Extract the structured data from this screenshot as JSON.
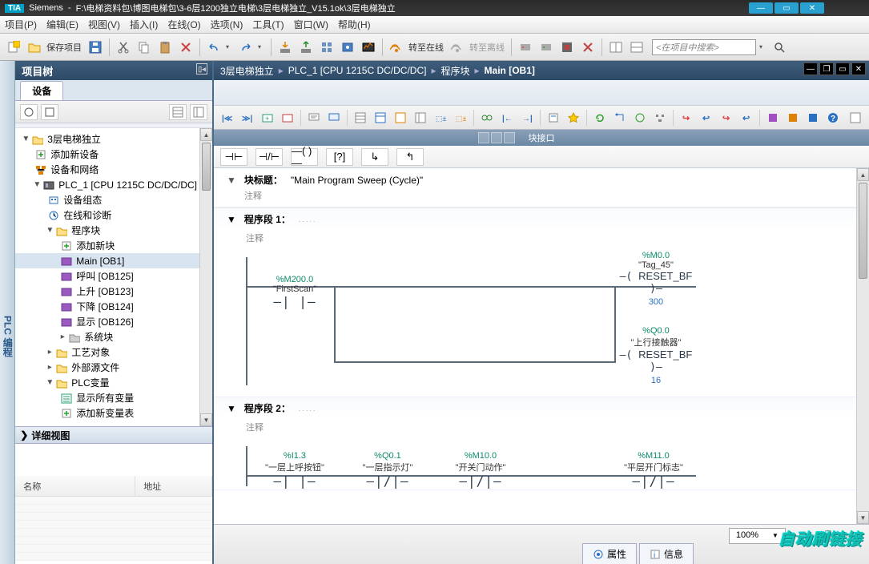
{
  "titlebar": {
    "logo": "TIA",
    "app": "Siemens",
    "path": "F:\\电梯资料包\\博图电梯包\\3-6层1200独立电梯\\3层电梯独立_V15.1ok\\3层电梯独立"
  },
  "menu": {
    "project": "项目(P)",
    "edit": "编辑(E)",
    "view": "视图(V)",
    "insert": "插入(I)",
    "online": "在线(O)",
    "options": "选项(N)",
    "tools": "工具(T)",
    "window": "窗口(W)",
    "help": "帮助(H)"
  },
  "toolbar": {
    "save": "保存项目",
    "go_online": "转至在线",
    "go_offline": "转至离线",
    "search_placeholder": "<在项目中搜索>"
  },
  "side_tab": "PLC 编程",
  "project_tree": {
    "title": "项目树",
    "tab": "设备",
    "root": "3层电梯独立",
    "add_device": "添加新设备",
    "devices_networks": "设备和网络",
    "plc": "PLC_1 [CPU 1215C DC/DC/DC]",
    "device_config": "设备组态",
    "online_diag": "在线和诊断",
    "program_blocks": "程序块",
    "add_block": "添加新块",
    "main": "Main [OB1]",
    "ob125": "呼叫 [OB125]",
    "ob123": "上升 [OB123]",
    "ob124": "下降 [OB124]",
    "ob126": "显示 [OB126]",
    "system_blocks": "系统块",
    "tech_objects": "工艺对象",
    "ext_sources": "外部源文件",
    "plc_tags": "PLC变量",
    "show_all_tags": "显示所有变量",
    "add_tag_table": "添加新变量表"
  },
  "detail": {
    "title": "详细视图",
    "col_name": "名称",
    "col_addr": "地址"
  },
  "editor": {
    "crumb1": "3层电梯独立",
    "crumb2": "PLC_1 [CPU 1215C DC/DC/DC]",
    "crumb3": "程序块",
    "crumb4": "Main [OB1]",
    "interface": "块接口",
    "block_title_label": "块标题：",
    "block_title_value": "\"Main Program Sweep (Cycle)\"",
    "comment": "注释",
    "network1": "程序段 1：",
    "network2": "程序段 2：",
    "zoom": "100%"
  },
  "rung1": {
    "contact_addr": "%M200.0",
    "contact_name": "\"FirstScan\"",
    "coil1_addr": "%M0.0",
    "coil1_name": "\"Tag_45\"",
    "coil1_func": "RESET_BF",
    "coil1_param": "300",
    "coil2_addr": "%Q0.0",
    "coil2_name": "\"上行接触器\"",
    "coil2_func": "RESET_BF",
    "coil2_param": "16"
  },
  "rung2": {
    "c1_addr": "%I1.3",
    "c1_name": "\"一层上呼按钮\"",
    "c2_addr": "%Q0.1",
    "c2_name": "\"一层指示灯\"",
    "c3_addr": "%M10.0",
    "c3_name": "\"开关门动作\"",
    "c4_addr": "%M11.0",
    "c4_name": "\"平层开门标志\""
  },
  "footer": {
    "properties": "属性",
    "info": "信息"
  },
  "watermark": "自动刷链接"
}
